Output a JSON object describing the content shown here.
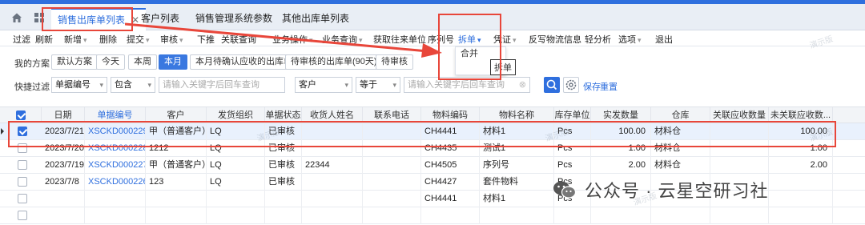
{
  "tabs": {
    "items": [
      {
        "label": "销售出库单列表",
        "close": "✕"
      },
      {
        "label": "客户列表"
      },
      {
        "label": "销售管理系统参数"
      },
      {
        "label": "其他出库单列表"
      }
    ]
  },
  "toolbar": {
    "items": [
      "过滤",
      "刷新",
      "新增",
      "删除",
      "提交",
      "审核",
      "下推",
      "关联查询",
      "业务操作",
      "业务查询",
      "获取往来单位",
      "序列号",
      "拆单",
      "凭证",
      "反写物流信息",
      "轻分析",
      "选项",
      "退出"
    ]
  },
  "split_menu": {
    "items": [
      "拆单",
      "合并"
    ],
    "tooltip": "拆单"
  },
  "scheme": {
    "label": "我的方案",
    "items": [
      "默认方案",
      "今天",
      "本周",
      "本月",
      "本月待确认应收的出库单",
      "待审核的出库单(90天)",
      "待审核"
    ],
    "active_index": 3
  },
  "quickfilter": {
    "label": "快捷过滤",
    "field1": "单据编号",
    "op1": "包含",
    "placeholder1": "请输入关键字后回车查询",
    "field2": "客户",
    "op2": "等于",
    "placeholder2": "请输入关键字后回车查询",
    "save": "保存",
    "reset": "重置"
  },
  "table": {
    "headers": [
      "日期",
      "单据编号",
      "客户",
      "发货组织",
      "单据状态",
      "收货人姓名",
      "联系电话",
      "物料编码",
      "物料名称",
      "库存单位",
      "实发数量",
      "仓库",
      "关联应收数量",
      "未关联应收数..."
    ],
    "rows": [
      {
        "checked": true,
        "cells": [
          "2023/7/21",
          "XSCKD000229",
          "甲（普通客户）",
          "LQ",
          "已审核",
          "",
          "",
          "CH4441",
          "材料1",
          "Pcs",
          "100.00",
          "材料仓",
          "",
          "100.00"
        ]
      },
      {
        "checked": false,
        "cells": [
          "2023/7/20",
          "XSCKD000228",
          "1212",
          "LQ",
          "已审核",
          "",
          "",
          "CH4435",
          "测试1",
          "Pcs",
          "1.00",
          "材料仓",
          "",
          "1.00"
        ]
      },
      {
        "checked": false,
        "cells": [
          "2023/7/19",
          "XSCKD000227",
          "甲（普通客户）",
          "LQ",
          "已审核",
          "22344",
          "",
          "CH4505",
          "序列号",
          "Pcs",
          "2.00",
          "材料仓",
          "",
          "2.00"
        ]
      },
      {
        "checked": false,
        "cells": [
          "2023/7/8",
          "XSCKD000226",
          "123",
          "LQ",
          "已审核",
          "",
          "",
          "CH4427",
          "套件物料",
          "Pcs",
          "",
          "",
          "",
          ""
        ]
      },
      {
        "checked": false,
        "cells": [
          "",
          "",
          "",
          "",
          "",
          "",
          "",
          "CH4441",
          "材料1",
          "Pcs",
          "",
          "",
          "",
          ""
        ]
      },
      {
        "checked": false,
        "cells": [
          "",
          "",
          "",
          "",
          "",
          "",
          "",
          "",
          "",
          "",
          "",
          "",
          "",
          ""
        ]
      }
    ]
  },
  "watermark": "演示版",
  "brand": "公众号 · 云星空研习社",
  "colors": {
    "accent": "#2f6fde",
    "highlight": "#e8463a"
  }
}
